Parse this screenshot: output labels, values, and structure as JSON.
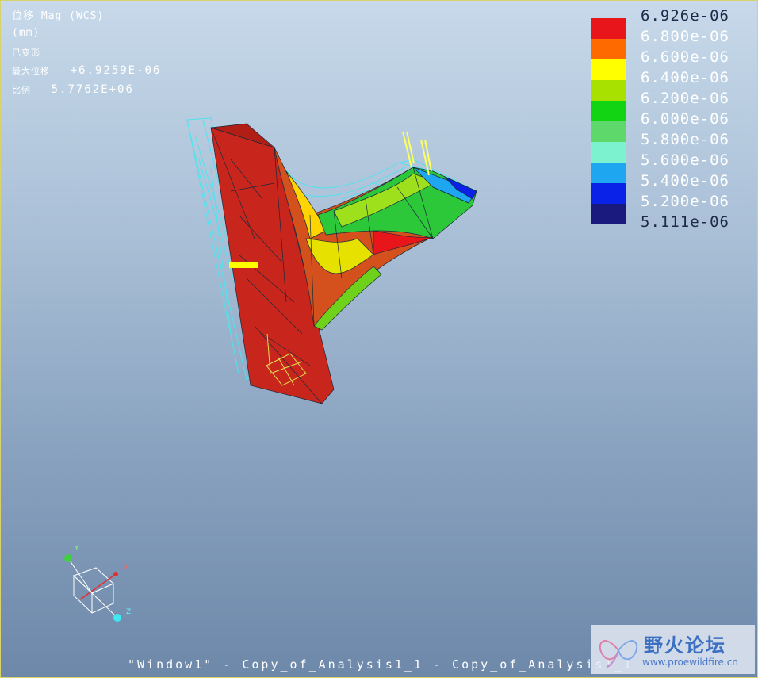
{
  "info": {
    "line1": "位移 Mag (WCS)",
    "line2": "(mm)",
    "line3": "已变形",
    "max_disp_label": "最大位移",
    "max_disp_value": "+6.9259E-06",
    "scale_label": "比例",
    "scale_value": "5.7762E+06"
  },
  "legend": {
    "labels": [
      "6.926e-06",
      "6.800e-06",
      "6.600e-06",
      "6.400e-06",
      "6.200e-06",
      "6.000e-06",
      "5.800e-06",
      "5.600e-06",
      "5.400e-06",
      "5.200e-06",
      "5.111e-06"
    ],
    "colors": [
      "#e8161a",
      "#ff6a00",
      "#ffff00",
      "#a8e000",
      "#12d412",
      "#5ed86a",
      "#7df2cf",
      "#1ea6f0",
      "#0a22e8",
      "#1a1a7e"
    ]
  },
  "triad": {
    "x_label": "X",
    "y_label": "Y",
    "z_label": "Z"
  },
  "footer": {
    "text": "\"Window1\" - Copy_of_Analysis1_1 - Copy_of_Analysis1_1"
  },
  "watermark": {
    "title": "野火论坛",
    "url": "www.proewildfire.cn"
  },
  "colors": {
    "wireframe": "#4fe3ee",
    "model_red": "#c8251c",
    "background_top": "#c7d9ea",
    "background_bottom": "#6e88aa"
  }
}
